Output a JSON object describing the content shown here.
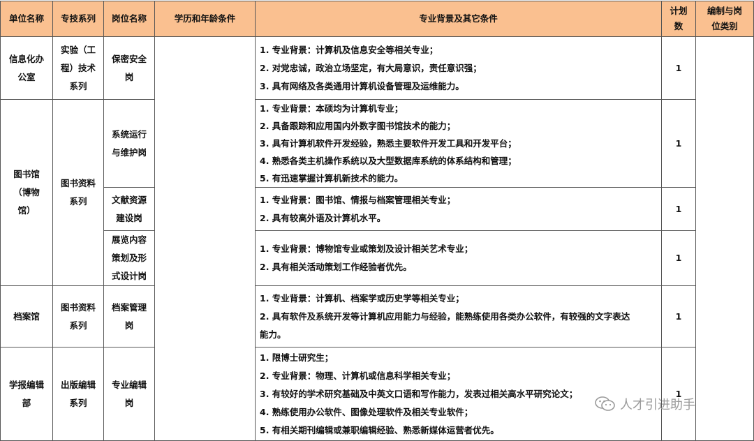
{
  "headers": {
    "unit": [
      "单位名称"
    ],
    "series": [
      "专技系列"
    ],
    "post": [
      "岗位名称"
    ],
    "edu": [
      "学历和年龄条件"
    ],
    "major": [
      "专业背景及其它条件"
    ],
    "plan": [
      "计划",
      "数"
    ],
    "category": [
      "编制与岗",
      "位类别"
    ]
  },
  "units": {
    "info": [
      "信息化办",
      "公室"
    ],
    "lib": [
      "图书馆",
      "（博物",
      "馆）"
    ],
    "archive": [
      "档案馆"
    ],
    "journal": [
      "学报编辑",
      "部"
    ]
  },
  "series": {
    "info": [
      "实验（工",
      "程）技术",
      "系列"
    ],
    "lib": [
      "图书资料",
      "系列"
    ],
    "archive": [
      "图书资料",
      "系列"
    ],
    "journal": [
      "出版编辑",
      "系列"
    ]
  },
  "posts": {
    "security": [
      "保密安全",
      "岗"
    ],
    "sysops": [
      "系统运行",
      "与维护岗"
    ],
    "literature": [
      "文献资源",
      "建设岗"
    ],
    "exhibit": [
      "展览内容",
      "策划及形",
      "式设计岗"
    ],
    "archive": [
      "档案管理",
      "岗"
    ],
    "editor": [
      "专业编辑",
      "岗"
    ]
  },
  "conditions": {
    "security": [
      "1. 专业背景：计算机及信息安全等相关专业；",
      "2. 对党忠诚，政治立场坚定，有大局意识，责任意识强；",
      "3. 具有网络及各类通用计算机设备管理及运维能力。"
    ],
    "sysops": [
      "1. 专业背景：本硕均为计算机专业；",
      "2. 具备跟踪和应用国内外数字图书馆技术的能力；",
      "3. 具有计算机软件开发经验，熟悉主要软件开发工具和开发平台；",
      "4. 熟悉各类主机操作系统以及大型数据库系统的体系结构和管理；",
      "5. 有迅速掌握计算机新技术的能力。"
    ],
    "literature": [
      "1. 专业背景：图书馆、情报与档案管理相关专业；",
      "2. 具有较高外语及计算机水平。"
    ],
    "exhibit": [
      "1. 专业背景：博物馆专业或策划及设计相关艺术专业；",
      "2. 具有相关活动策划工作经验者优先。"
    ],
    "archive": [
      "1. 专业背景：计算机、档案学或历史学等相关专业；",
      "2. 具有软件及系统开发等计算机应用能力与经验，能熟练使用各类办公软件，有较强的文字表达",
      "能力。"
    ],
    "editor": [
      "1. 限博士研究生；",
      "2. 专业背景：物理、计算机或信息科学相关专业；",
      "3. 有较好的学术研究基础及中英文口语和写作能力，发表过相关高水平研究论文；",
      "4. 熟练使用办公软件、图像处理软件及相关专业软件；",
      "5. 有相关期刊编辑或兼职编辑经验、熟悉新媒体运营者优先。"
    ]
  },
  "plan_counts": {
    "security": "1",
    "sysops": "1",
    "literature": "1",
    "exhibit": "1",
    "archive": "1",
    "editor": "1"
  },
  "watermark": {
    "text": "人才引进助手",
    "icon": "wechat-icon"
  }
}
